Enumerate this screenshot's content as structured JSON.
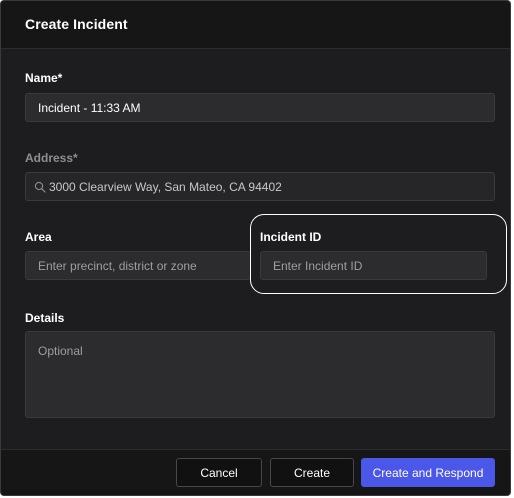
{
  "dialog": {
    "title": "Create Incident"
  },
  "form": {
    "name": {
      "label": "Name*",
      "value": "Incident - 11:33 AM"
    },
    "address": {
      "label": "Address*",
      "value": "3000 Clearview Way, San Mateo, CA 94402",
      "icon": "search-icon"
    },
    "area": {
      "label": "Area",
      "placeholder": "Enter precinct, district or zone"
    },
    "incident_id": {
      "label": "Incident ID",
      "placeholder": "Enter Incident ID"
    },
    "details": {
      "label": "Details",
      "placeholder": "Optional"
    }
  },
  "footer": {
    "cancel_label": "Cancel",
    "create_label": "Create",
    "create_respond_label": "Create and Respond"
  },
  "colors": {
    "background": "#1d1d1f",
    "header": "#161617",
    "field": "#2c2c2e",
    "primary": "#4a57e8",
    "highlight": "#ffffff"
  }
}
